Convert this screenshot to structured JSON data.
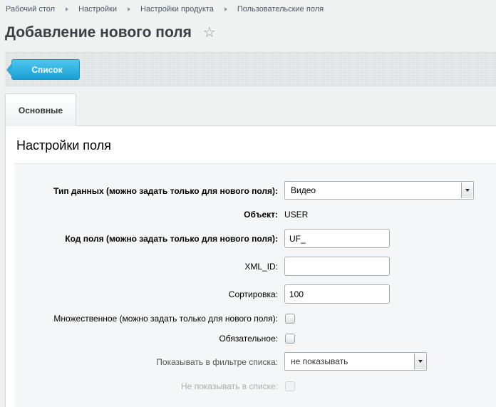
{
  "breadcrumb": [
    "Рабочий стол",
    "Настройки",
    "Настройки продукта",
    "Пользовательские поля"
  ],
  "page": {
    "title": "Добавление нового поля",
    "star": "☆"
  },
  "toolbar": {
    "list_button": "Список"
  },
  "tabs": [
    {
      "label": "Основные"
    }
  ],
  "section": {
    "title": "Настройки поля"
  },
  "form": {
    "data_type": {
      "label": "Тип данных (можно задать только для нового поля):",
      "value": "Видео"
    },
    "object": {
      "label": "Объект:",
      "value": "USER"
    },
    "field_code": {
      "label": "Код поля (можно задать только для нового поля):",
      "value": "UF_"
    },
    "xml_id": {
      "label": "XML_ID:",
      "value": ""
    },
    "sort": {
      "label": "Сортировка:",
      "value": "100"
    },
    "multiple": {
      "label": "Множественное (можно задать только для нового поля):",
      "checked": false
    },
    "required": {
      "label": "Обязательное:",
      "checked": false
    },
    "show_filter": {
      "label": "Показывать в фильтре списка:",
      "value": "не показывать"
    },
    "hide_in_list": {
      "label": "Не показывать в списке:",
      "checked": false,
      "disabled": true
    }
  },
  "colors": {
    "accent": "#1aa0d6",
    "background": "#f0f2f2"
  }
}
